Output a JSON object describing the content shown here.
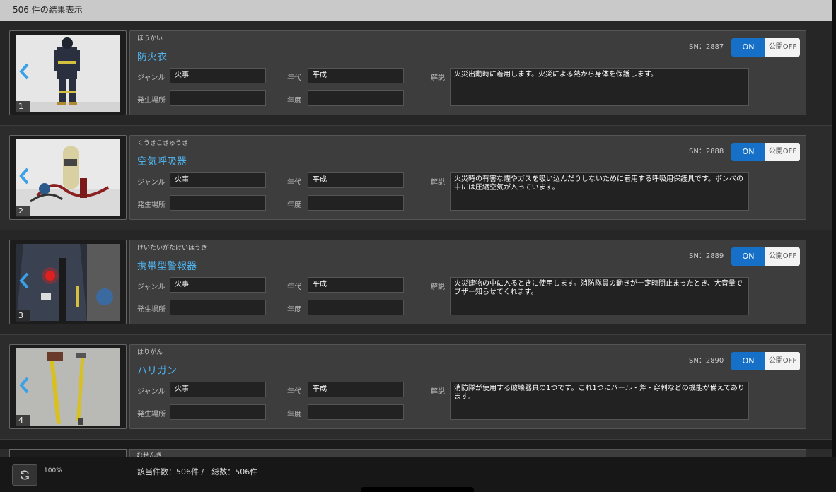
{
  "header": {
    "results_text": "506 件の結果表示"
  },
  "labels": {
    "genre": "ジャンル",
    "era": "年代",
    "place": "発生場所",
    "year": "年度",
    "description": "解説"
  },
  "toggle": {
    "on": "ON",
    "off": "公開OFF"
  },
  "records": [
    {
      "index": "1",
      "furigana": "ほうかい",
      "title": "防火衣",
      "sn": "SN：2887",
      "genre": "火事",
      "era": "平成",
      "place": "",
      "year": "",
      "description": "火災出動時に着用します。火災による熱から身体を保護します。"
    },
    {
      "index": "2",
      "furigana": "くうきこきゅうき",
      "title": "空気呼吸器",
      "sn": "SN：2888",
      "genre": "火事",
      "era": "平成",
      "place": "",
      "year": "",
      "description": "火災時の有害な煙やガスを吸い込んだりしないために着用する呼吸用保護具です。ボンベの中には圧縮空気が入っています。"
    },
    {
      "index": "3",
      "furigana": "けいたいがたけいほうき",
      "title": "携帯型警報器",
      "sn": "SN：2889",
      "genre": "火事",
      "era": "平成",
      "place": "",
      "year": "",
      "description": "火災建物の中に入るときに使用します。消防隊員の動きが一定時間止まったとき、大音量でブザー知らせてくれます。"
    },
    {
      "index": "4",
      "furigana": "はりがん",
      "title": "ハリガン",
      "sn": "SN：2890",
      "genre": "火事",
      "era": "平成",
      "place": "",
      "year": "",
      "description": "消防隊が使用する破壊器具の1つです。これ1つにバール・斧・穿刺などの機能が備えてあります。"
    }
  ],
  "partial_record": {
    "furigana": "むせんき"
  },
  "footer": {
    "zoom": "100%",
    "counts": "該当件数：506件 /　総数：506件"
  }
}
